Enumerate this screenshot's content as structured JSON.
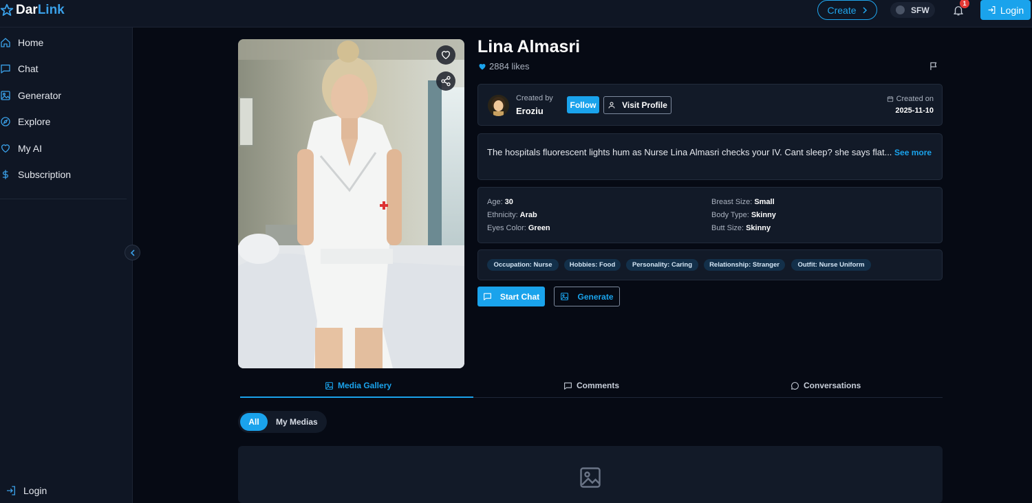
{
  "header": {
    "logo_part1": "Dar",
    "logo_part2": "Link",
    "create_label": "Create",
    "sfw_label": "SFW",
    "notification_count": "1",
    "login_label": "Login"
  },
  "sidebar": {
    "items": [
      {
        "label": "Home",
        "icon": "home-icon"
      },
      {
        "label": "Chat",
        "icon": "chat-icon"
      },
      {
        "label": "Generator",
        "icon": "image-icon"
      },
      {
        "label": "Explore",
        "icon": "compass-icon"
      },
      {
        "label": "My AI",
        "icon": "heart-icon"
      },
      {
        "label": "Subscription",
        "icon": "dollar-icon"
      }
    ],
    "login_label": "Login"
  },
  "character": {
    "name": "Lina Almasri",
    "likes": "2884 likes",
    "created_by_label": "Created by",
    "creator": "Eroziu",
    "follow_label": "Follow",
    "visit_profile_label": "Visit Profile",
    "created_on_label": "Created on",
    "created_on": "2025-11-10",
    "description": "The hospitals fluorescent lights hum as Nurse Lina Almasri checks your IV. Cant sleep? she says flat...",
    "see_more_label": "See more",
    "attributes": {
      "age_label": "Age:",
      "age": "30",
      "ethnicity_label": "Ethnicity:",
      "ethnicity": "Arab",
      "eyes_label": "Eyes Color:",
      "eyes": "Green",
      "breast_label": "Breast Size:",
      "breast": "Small",
      "body_label": "Body Type:",
      "body": "Skinny",
      "butt_label": "Butt Size:",
      "butt": "Skinny"
    },
    "tags": [
      "Occupation: Nurse",
      "Hobbies: Food",
      "Personality: Caring",
      "Relationship: Stranger",
      "Outfit: Nurse Uniform"
    ],
    "start_chat_label": "Start Chat",
    "generate_label": "Generate"
  },
  "tabs": {
    "media_gallery": "Media Gallery",
    "comments": "Comments",
    "conversations": "Conversations"
  },
  "filters": {
    "all": "All",
    "my_medias": "My Medias"
  },
  "colors": {
    "accent": "#1aa3ec",
    "background": "#060a14",
    "panel": "#121a28",
    "badge": "#e53935"
  }
}
